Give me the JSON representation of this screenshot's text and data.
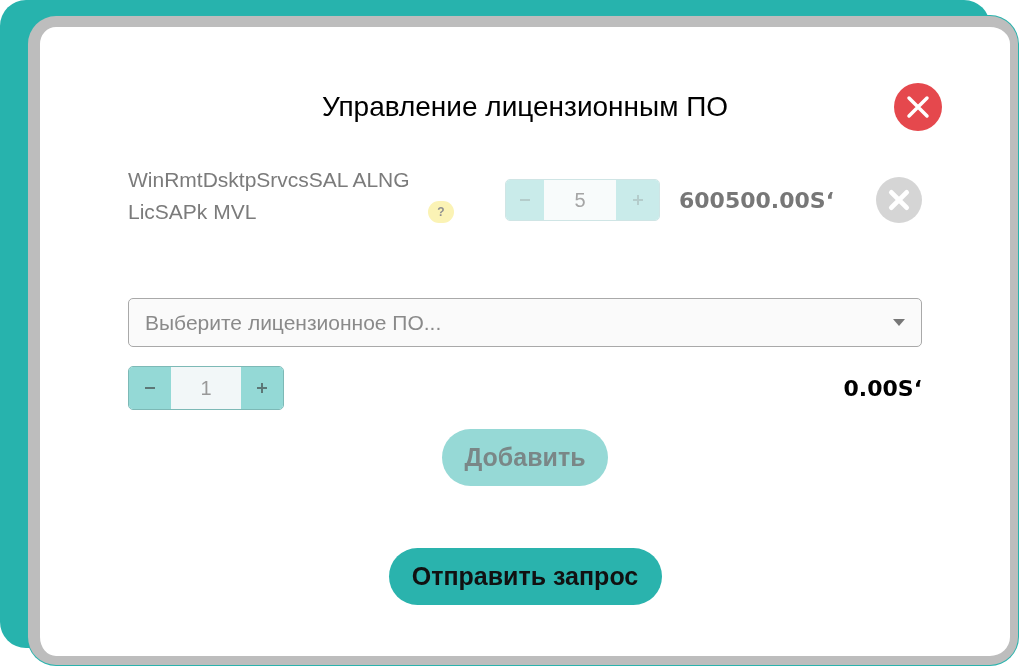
{
  "window": {
    "title": "Управление лицензионным ПО"
  },
  "licenses": [
    {
      "name": "WinRmtDsktpSrvcsSAL ALNG LicSAPk MVL",
      "help": "?",
      "quantity": "5",
      "disabled": true,
      "price": "600500.00S‘"
    }
  ],
  "new_license": {
    "placeholder": "Выберите лицензионное ПО...",
    "quantity": "1",
    "disabled": false,
    "price": "0.00S‘",
    "add_button": {
      "label": "Добавить",
      "disabled": true
    }
  },
  "submit_button": {
    "label": "Отправить запрос"
  }
}
